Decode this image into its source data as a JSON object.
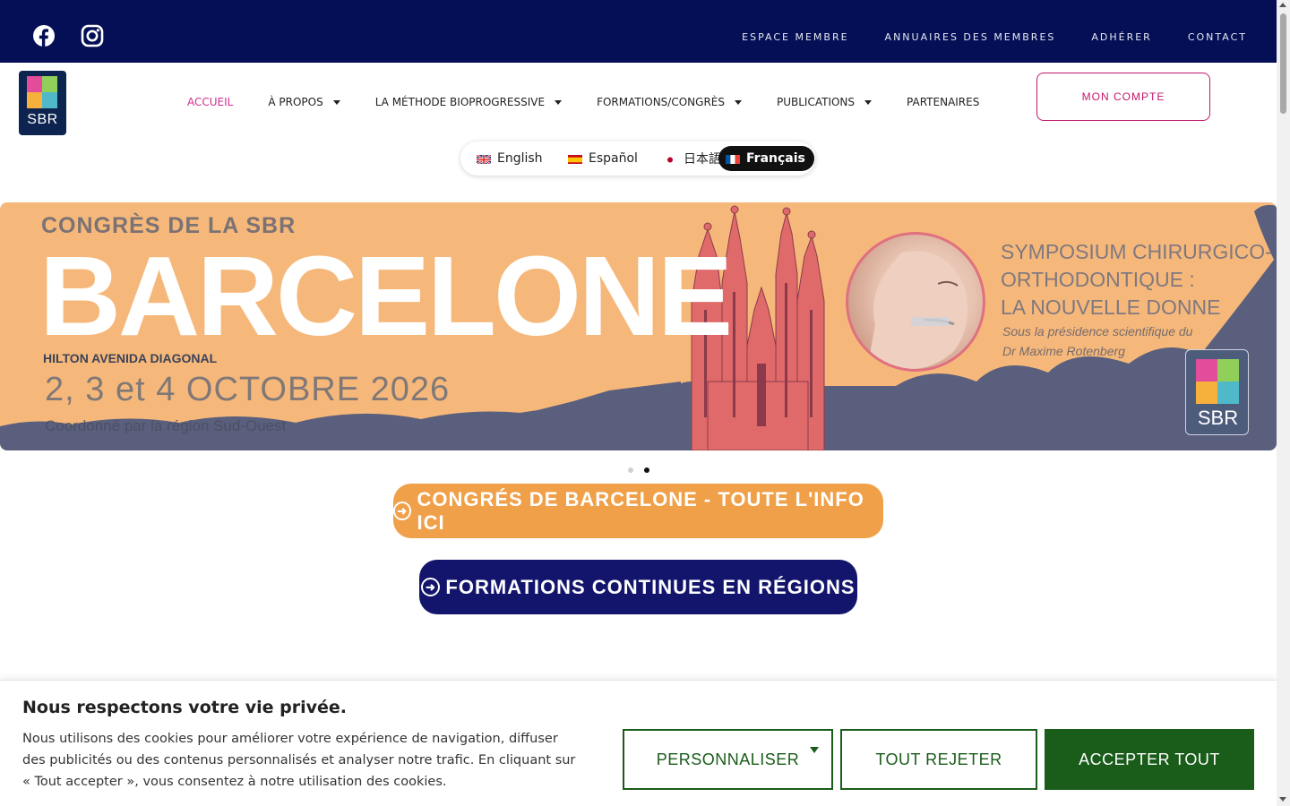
{
  "colors": {
    "topbar": "#050f55",
    "accent_pink": "#d1308f",
    "cta_orange": "#f0a048",
    "cta_navy": "#12156b",
    "cookie_green": "#1a5c1a",
    "banner_bg": "#f6b87a"
  },
  "social": [
    {
      "name": "facebook-icon"
    },
    {
      "name": "instagram-icon"
    }
  ],
  "toplinks": [
    "ESPACE MEMBRE",
    "ANNUAIRES DES MEMBRES",
    "ADHÉRER",
    "CONTACT"
  ],
  "logo": {
    "text": "SBR"
  },
  "nav": [
    {
      "label": "ACCUEIL",
      "active": true,
      "dropdown": false
    },
    {
      "label": "À PROPOS",
      "dropdown": true
    },
    {
      "label": "LA MÉTHODE BIOPROGRESSIVE",
      "dropdown": true
    },
    {
      "label": "FORMATIONS/CONGRÈS",
      "dropdown": true
    },
    {
      "label": "PUBLICATIONS",
      "dropdown": true
    },
    {
      "label": "PARTENAIRES",
      "dropdown": false
    }
  ],
  "account_button": "MON COMPTE",
  "languages": [
    {
      "label": "English",
      "flag": "uk"
    },
    {
      "label": "Español",
      "flag": "es"
    },
    {
      "label": "日本語",
      "flag": "jp"
    },
    {
      "label": "Français",
      "flag": "fr",
      "active": true
    }
  ],
  "banner": {
    "congress_line": "CONGRÈS DE LA SBR",
    "city": "BARCELONE",
    "hotel": "HILTON AVENIDA DIAGONAL",
    "date": "2, 3 et 4 OCTOBRE 2026",
    "coordination": "Coordonné par la région Sud-Ouest",
    "symposium_line1": "SYMPOSIUM CHIRURGICO-ORTHODONTIQUE :",
    "symposium_line2": "LA NOUVELLE DONNE",
    "sub_line1": "Sous la présidence scientifique du",
    "sub_line2": "Dr Maxime Rotenberg",
    "logo_text": "SBR"
  },
  "carousel": {
    "slides": 2,
    "active": 2
  },
  "cta": [
    {
      "label": "CONGRÉS DE BARCELONE - TOUTE L'INFO ICI",
      "icon": "arrow-circle-right-icon"
    },
    {
      "label": "FORMATIONS CONTINUES EN RÉGIONS",
      "icon": "arrow-circle-right-icon"
    }
  ],
  "cookie": {
    "title": "Nous respectons votre vie privée.",
    "text": "Nous utilisons des cookies pour améliorer votre expérience de navigation, diffuser des publicités ou des contenus personnalisés et analyser notre trafic. En cliquant sur « Tout accepter », vous consentez à notre utilisation des cookies.",
    "customize": "PERSONNALISER",
    "reject": "TOUT REJETER",
    "accept": "ACCEPTER TOUT"
  }
}
